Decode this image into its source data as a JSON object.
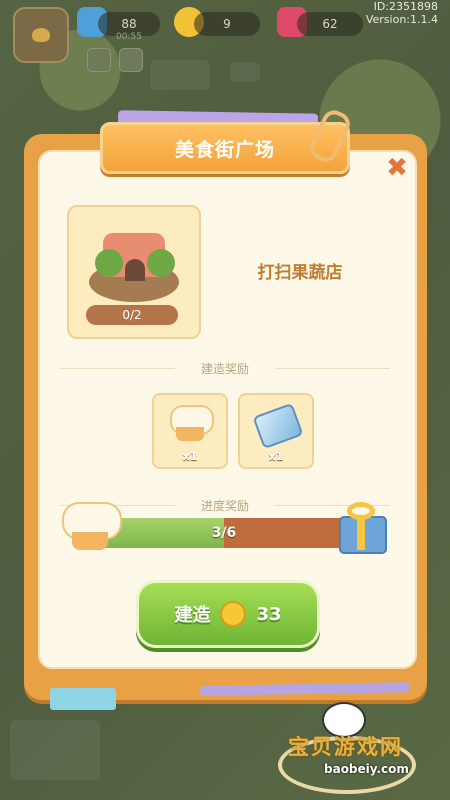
{
  "hud": {
    "avatar_icon": "bird-icon",
    "resources": [
      {
        "icon": "blue-gem-icon",
        "value": "88",
        "sub": "00:55"
      },
      {
        "icon": "gold-coin-icon",
        "value": "9"
      },
      {
        "icon": "red-gem-icon",
        "value": "62"
      }
    ],
    "id_text": "ID:2351898",
    "version_text": "Version:1.1.4"
  },
  "dialog": {
    "title": "美食街广场",
    "close_icon": "close-icon",
    "building": {
      "progress_text": "0/2"
    },
    "task_name": "打扫果蔬店",
    "build_reward": {
      "label": "建造奖励",
      "items": [
        {
          "icon": "chef-hat-icon",
          "qty": "x1"
        },
        {
          "icon": "ice-block-icon",
          "qty": "x1"
        }
      ]
    },
    "progress_reward": {
      "label": "进度奖励",
      "current": 3,
      "total": 6,
      "text": "3/6",
      "start_icon": "chef-hat-icon",
      "end_icon": "gift-box-icon"
    },
    "build_button": {
      "label": "建造",
      "coin_icon": "gold-coin-icon",
      "cost": "33"
    }
  },
  "watermark": {
    "cn": "宝贝游戏网",
    "en": "baobeiy.com"
  },
  "colors": {
    "dialog_frame": "#e8a245",
    "dialog_panel": "#fdf8e8",
    "title_text": "#ffffff",
    "task_text": "#c07d2f",
    "progress_fill": "#7fb74b",
    "progress_track": "#bf6c3d",
    "build_button": "#6fb535"
  }
}
